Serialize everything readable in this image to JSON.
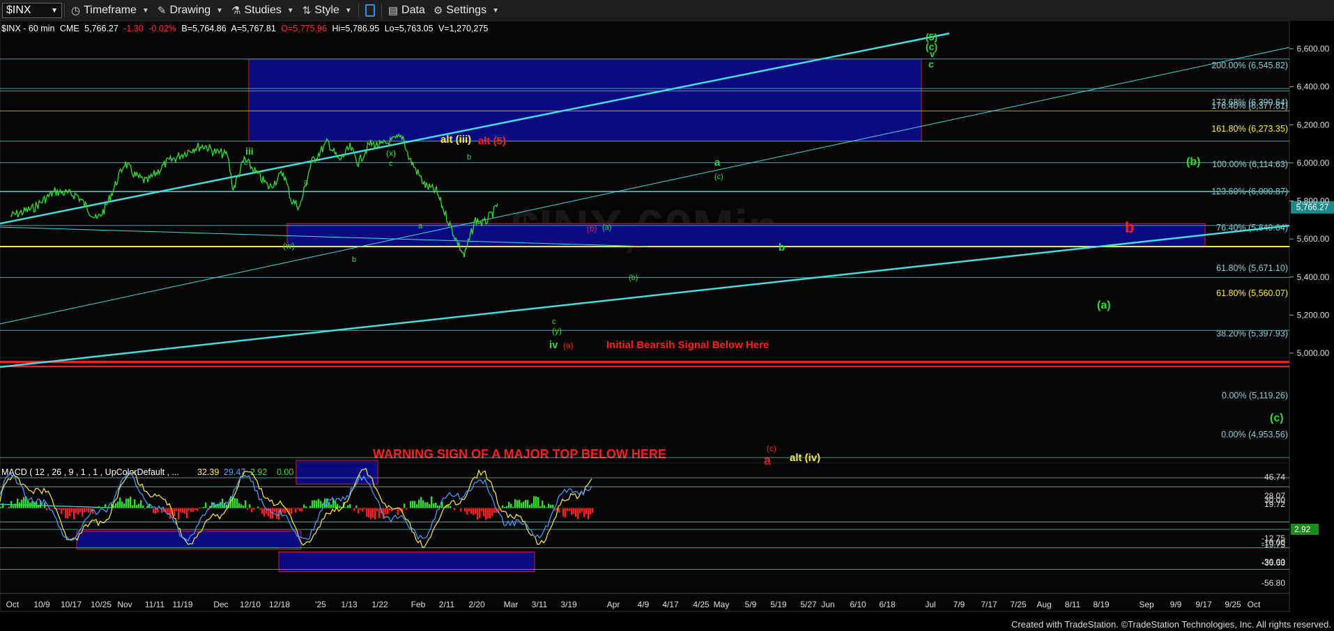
{
  "toolbar": {
    "symbol": "$INX",
    "timeframe": "Timeframe",
    "drawing": "Drawing",
    "studies": "Studies",
    "style": "Style",
    "data": "Data",
    "settings": "Settings"
  },
  "header": {
    "name": "$INX - 60 min",
    "exchange": "CME",
    "last": "5,766.27",
    "change": "-1.30",
    "pct": "-0.02%",
    "bid": "B=5,764.86",
    "ask": "A=5,767.81",
    "open": "O=5,775.96",
    "high": "Hi=5,786.95",
    "low": "Lo=5,763.05",
    "volume": "V=1,270,275"
  },
  "watermark": "$INX,60Min",
  "colors": {
    "green": "#33dd33",
    "red": "#ff2020",
    "yellow": "#ffee44",
    "cyan": "#33cccc",
    "box_blue": "#0a0a80"
  },
  "chart_data": [
    {
      "type": "line",
      "series": [
        {
          "x": [
            "2024-10-01",
            "2024-10-09",
            "2024-10-17",
            "2024-10-25",
            "2024-11-01",
            "2024-11-04",
            "2024-11-11",
            "2024-11-15",
            "2024-11-19",
            "2024-11-26",
            "2024-12-06",
            "2024-12-10",
            "2024-12-13",
            "2024-12-18",
            "2024-12-20",
            "2024-12-24",
            "2025-01-02",
            "2025-01-07",
            "2025-01-10",
            "2025-01-13",
            "2025-01-17",
            "2025-01-23",
            "2025-01-27",
            "2025-01-31",
            "2025-02-03",
            "2025-02-07",
            "2025-02-11",
            "2025-02-19",
            "2025-02-21",
            "2025-02-27",
            "2025-03-03",
            "2025-03-06",
            "2025-03-10",
            "2025-03-13",
            "2025-03-17",
            "2025-03-20",
            "2025-03-24",
            "2025-03-25"
          ],
          "values": [
            5720,
            5760,
            5850,
            5830,
            5700,
            5760,
            6000,
            5930,
            5900,
            6000,
            6080,
            6090,
            6060,
            6040,
            5860,
            6020,
            5870,
            5950,
            5800,
            5770,
            6000,
            6110,
            6010,
            6080,
            6000,
            6100,
            6090,
            6140,
            6030,
            5880,
            5850,
            5740,
            5600,
            5510,
            5700,
            5680,
            5750,
            5786
          ]
        }
      ],
      "y_ticks": [
        "5,000.00",
        "5,200.00",
        "5,400.00",
        "5,600.00",
        "5,800.00",
        "6,000.00",
        "6,200.00",
        "6,400.00",
        "6,600.00"
      ],
      "last_price_label": "5,766.27",
      "x_ticks": [
        "Oct",
        "10/9",
        "10/17",
        "10/25",
        "Nov",
        "11/11",
        "11/19",
        "Dec",
        "12/10",
        "12/18",
        "'25",
        "1/13",
        "1/22",
        "Feb",
        "2/11",
        "2/20",
        "Mar",
        "3/11",
        "3/19",
        "Apr",
        "4/9",
        "4/17",
        "4/25",
        "May",
        "5/9",
        "5/19",
        "5/27",
        "Jun",
        "6/10",
        "6/18",
        "Jul",
        "7/9",
        "7/17",
        "7/25",
        "Aug",
        "8/11",
        "8/19",
        "Sep",
        "9/9",
        "9/17",
        "9/25",
        "Oct"
      ],
      "fib_levels": [
        {
          "label": "200.00% (6,545.82)",
          "value": 6545.82
        },
        {
          "label": "173.68% (6,390.64)",
          "value": 6390.64
        },
        {
          "label": "176.40% (6,377.81)",
          "value": 6377.81
        },
        {
          "label": "161.80% (6,273.35)",
          "value": 6273.35
        },
        {
          "label": "100.00% (6,114.63)",
          "value": 6114.63
        },
        {
          "label": "123.60% (6,000.87)",
          "value": 6000.87
        },
        {
          "label": "76.40% (5,849.64)",
          "value": 5849.64
        },
        {
          "label": "61.80% (5,671.10)",
          "value": 5671.1
        },
        {
          "label": "61.80% (5,560.07)",
          "value": 5560.07
        },
        {
          "label": "38.20% (5,397.93)",
          "value": 5397.93
        },
        {
          "label": "0.00% (5,119.26)",
          "value": 5119.26
        },
        {
          "label": "0.00% (4,953.56)",
          "value": 4953.56
        }
      ],
      "annotations": {
        "warning": "WARNING SIGN OF A MAJOR TOP BELOW HERE",
        "bearish": "Initial Bearsih Signal Below Here",
        "alt_iii": "alt (iii)",
        "alt_5": "alt (5)",
        "alt_iv": "alt (iv)",
        "b_red": "b",
        "a_red": "a",
        "c_red": "(c)",
        "a_paren_red": "(a)",
        "b_paren_red": "(b)",
        "green_a_paren": "(a)",
        "green_b_paren": "(b)",
        "green_c_paren": "(c)",
        "green_iii": "iii",
        "green_iv": "iv",
        "green_w": "(w)",
        "green_x": "(x)",
        "green_y": "(y)",
        "green_a": "a",
        "green_b": "b",
        "green_c": "c",
        "green_v": "v",
        "green_5": "(5)",
        "green_cparen_top": "(c)"
      }
    },
    {
      "type": "line",
      "title": "MACD ( 12 , 26 , 9 , 1 , 1 , UpColorDefault , ...",
      "legend_values": [
        "32.39",
        "29.47",
        "2.92",
        "0.00"
      ],
      "y_ticks": [
        "46.74",
        "28.07",
        "19.72",
        "30.00",
        "-12.75",
        "-10.00",
        "-19.75",
        "-30.00",
        "-36.63",
        "-56.80"
      ],
      "last_value_label": "2.92"
    }
  ],
  "footer": "Created with TradeStation. ©TradeStation Technologies, Inc. All rights reserved."
}
